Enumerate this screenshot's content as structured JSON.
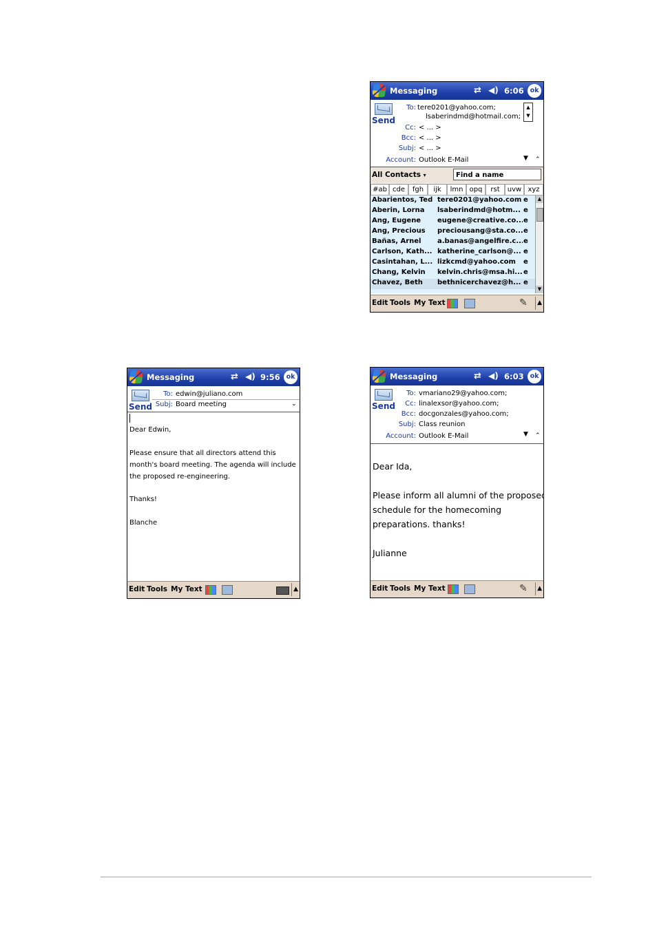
{
  "status": {
    "app_title": "Messaging",
    "ok": "ok"
  },
  "menu": {
    "edit": "Edit",
    "tools": "Tools",
    "my_text": "My Text"
  },
  "send_label": "Send",
  "shotA": {
    "time": "6:06",
    "to_label": "To:",
    "to_line1": "tere0201@yahoo.com;",
    "to_line2": "lsaberindmd@hotmail.com;",
    "cc_label": "Cc:",
    "cc_value": "< ... >",
    "bcc_label": "Bcc:",
    "bcc_value": "< ... >",
    "subj_label": "Subj:",
    "subj_value": "< ... >",
    "account_label": "Account:",
    "account_value": "Outlook E-Mail",
    "contacts_filter": "All Contacts",
    "find_placeholder": "Find a name",
    "tabs": [
      "#ab",
      "cde",
      "fgh",
      "ijk",
      "lmn",
      "opq",
      "rst",
      "uvw",
      "xyz"
    ],
    "contacts": [
      {
        "name": "Abarientos, Ted",
        "email": "tere0201@yahoo.com",
        "type": "e"
      },
      {
        "name": "Aberin, Lorna",
        "email": "lsaberindmd@hotm...",
        "type": "e"
      },
      {
        "name": "Ang, Eugene",
        "email": "eugene@creative.co...",
        "type": "e"
      },
      {
        "name": "Ang, Precious",
        "email": "preciousang@sta.co...",
        "type": "e"
      },
      {
        "name": "Bañas, Arnel",
        "email": "a.banas@angelfire.c...",
        "type": "e"
      },
      {
        "name": "Carlson, Kath...",
        "email": "katherine_carlson@...",
        "type": "e"
      },
      {
        "name": "Casintahan, L...",
        "email": "lizkcmd@yahoo.com",
        "type": "e"
      },
      {
        "name": "Chang, Kelvin",
        "email": "kelvin.chris@msa.hi...",
        "type": "e"
      },
      {
        "name": "Chavez, Beth",
        "email": "bethnicerchavez@h...",
        "type": "e"
      }
    ]
  },
  "shotB": {
    "time": "9:56",
    "to_label": "To:",
    "to_value": "edwin@juliano.com",
    "subj_label": "Subj:",
    "subj_value": "Board meeting",
    "body": [
      "Dear Edwin,",
      "Please ensure that all directors attend this",
      "month's board meeting. The agenda will include",
      "the proposed re-engineering.",
      "Thanks!",
      "Blanche"
    ]
  },
  "shotC": {
    "time": "6:03",
    "to_label": "To:",
    "to_value": "vmariano29@yahoo.com;",
    "cc_label": "Cc:",
    "cc_value": "linalexsor@yahoo.com;",
    "bcc_label": "Bcc:",
    "bcc_value": "docgonzales@yahoo.com;",
    "subj_label": "Subj:",
    "subj_value": "Class reunion",
    "account_label": "Account:",
    "account_value": "Outlook E-Mail",
    "body": [
      "Dear Ida,",
      "Please inform all alumni of the proposed",
      "schedule for the homecoming",
      "preparations. thanks!",
      "Julianne"
    ]
  }
}
